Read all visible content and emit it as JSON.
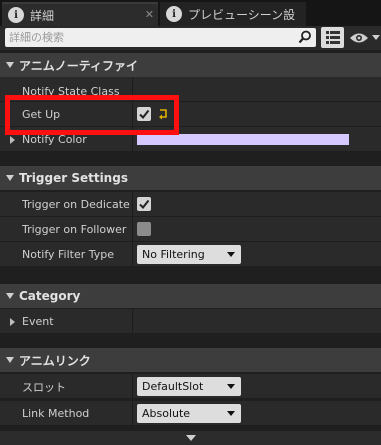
{
  "tabs": [
    {
      "label": "詳細",
      "close": "✕"
    },
    {
      "label": "プレビューシーン設"
    }
  ],
  "search": {
    "placeholder": "詳細の検索"
  },
  "categories": {
    "anim_notify": "アニムノーティファイ",
    "trigger": "Trigger Settings",
    "category": "Category",
    "anim_link": "アニムリンク"
  },
  "rows": {
    "notify_state_class": "Notify State Class",
    "get_up": {
      "label": "Get Up",
      "checked": true
    },
    "notify_color": {
      "label": "Notify Color",
      "color": "#d6c9ff"
    },
    "trigger_dedicated": {
      "label": "Trigger on Dedicated S",
      "checked": true
    },
    "trigger_follower": {
      "label": "Trigger on Follower",
      "checked": false
    },
    "notify_filter": {
      "label": "Notify Filter Type",
      "value": "No Filtering"
    },
    "event": "Event",
    "slot": {
      "label": "スロット",
      "value": "DefaultSlot"
    },
    "link_method": {
      "label": "Link Method",
      "value": "Absolute"
    }
  },
  "highlight_color": "#ff1010"
}
